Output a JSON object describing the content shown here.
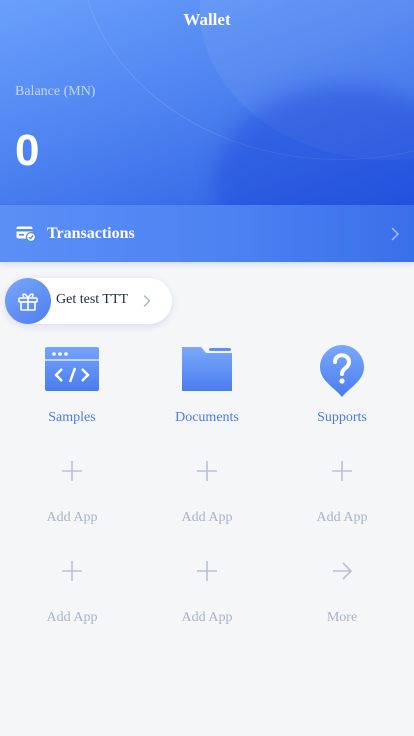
{
  "header": {
    "title": "Wallet",
    "balance_label": "Balance (MN)",
    "balance_value": "0"
  },
  "transactions": {
    "label": "Transactions",
    "icon": "wallet-card-icon"
  },
  "promo": {
    "label": "Get test TTT",
    "icon": "gift-icon"
  },
  "apps": [
    {
      "label": "Samples",
      "icon": "code-window-icon"
    },
    {
      "label": "Documents",
      "icon": "folder-icon"
    },
    {
      "label": "Supports",
      "icon": "question-bubble-icon"
    },
    {
      "label": "Add App",
      "icon": "plus-icon"
    },
    {
      "label": "Add App",
      "icon": "plus-icon"
    },
    {
      "label": "Add App",
      "icon": "plus-icon"
    },
    {
      "label": "Add App",
      "icon": "plus-icon"
    },
    {
      "label": "Add App",
      "icon": "plus-icon"
    },
    {
      "label": "More",
      "icon": "arrow-right-icon"
    }
  ],
  "colors": {
    "accent": "#4a7ae8",
    "muted": "#a9b3c7",
    "background": "#f5f6f8"
  }
}
